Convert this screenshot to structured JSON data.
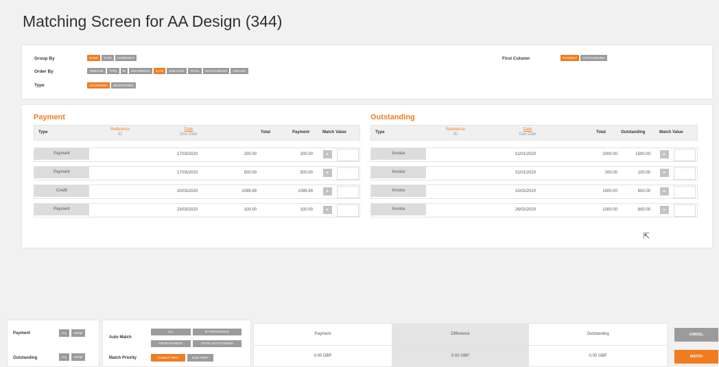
{
  "page": {
    "title": "Matching Screen for AA Design (344)"
  },
  "options": {
    "group_by": {
      "label": "Group By",
      "options": [
        "NONE",
        "TYPE",
        "CURRENCY"
      ],
      "selected": "NONE"
    },
    "order_by": {
      "label": "Order By",
      "options": [
        "TIMELINE",
        "TYPE",
        "ID",
        "REFERENCE",
        "DATE",
        "DUE DATE",
        "TOTAL",
        "OUTSTANDING",
        "AMOUNT"
      ],
      "selected": "DATE"
    },
    "type": {
      "label": "Type",
      "options": [
        "ASCENDING",
        "DESCENDING"
      ],
      "selected": "ASCENDING"
    },
    "first_column": {
      "label": "First Column",
      "options": [
        "PAYMENT",
        "OUTSTANDING"
      ],
      "selected": "PAYMENT"
    }
  },
  "payment": {
    "title": "Payment",
    "headers": {
      "type": "Type",
      "reference": "Reference",
      "id": "ID",
      "date": "Date",
      "due_date": "Due Date",
      "total": "Total",
      "payment": "Payment",
      "match_value": "Match Value"
    },
    "rows": [
      {
        "type": "Payment",
        "date": "17/03/2020",
        "total": "200.00",
        "payment": "200.00"
      },
      {
        "type": "Payment",
        "date": "17/03/2020",
        "total": "500.00",
        "payment": "500.00"
      },
      {
        "type": "Credit",
        "date": "20/03/2020",
        "total": "1099.99",
        "payment": "1099.99"
      },
      {
        "type": "Payment",
        "date": "23/03/2020",
        "total": "100.00",
        "payment": "100.00"
      }
    ]
  },
  "outstanding": {
    "title": "Outstanding",
    "headers": {
      "type": "Type",
      "reference": "Reference",
      "id": "ID",
      "date": "Date",
      "due_date": "Due Date",
      "total": "Total",
      "outstanding": "Outstanding",
      "match_value": "Match Value"
    },
    "rows": [
      {
        "type": "Invoice",
        "due_date": "01/01/2020",
        "total": "2000.00",
        "outstanding": "1500.00"
      },
      {
        "type": "Invoice",
        "due_date": "31/01/2020",
        "total": "200.00",
        "outstanding": "100.00"
      },
      {
        "type": "Invoice",
        "due_date": "10/02/2020",
        "total": "1000.00",
        "outstanding": "800.00"
      },
      {
        "type": "Invoice",
        "due_date": "26/02/2020",
        "total": "1000.00",
        "outstanding": "800.00"
      }
    ]
  },
  "bottom": {
    "payment_label": "Payment",
    "outstanding_label": "Outstanding",
    "all": "ALL",
    "none": "NONE",
    "auto_match_label": "Auto Match",
    "auto_all": "ALL",
    "auto_by_reference": "BY REFERENCE",
    "auto_from_payment": "FROM PAYMENT",
    "auto_from_outstanding": "FROM OUTSTANDING",
    "match_priority_label": "Match Priority",
    "oldest_first": "OLDEST FIRST",
    "due_first": "DUE FIRST",
    "summary": {
      "payment_label": "Payment",
      "payment_value": "0.00 GBP",
      "difference_label": "Difference",
      "difference_value": "0.00 GBP",
      "outstanding_label": "Outstanding",
      "outstanding_value": "0.00 GBP"
    },
    "cancel": "CANCEL",
    "match": "MATCH"
  },
  "colors": {
    "accent": "#f07c22",
    "pill_grey": "#9b9b9b",
    "background": "#f1f1f1"
  }
}
